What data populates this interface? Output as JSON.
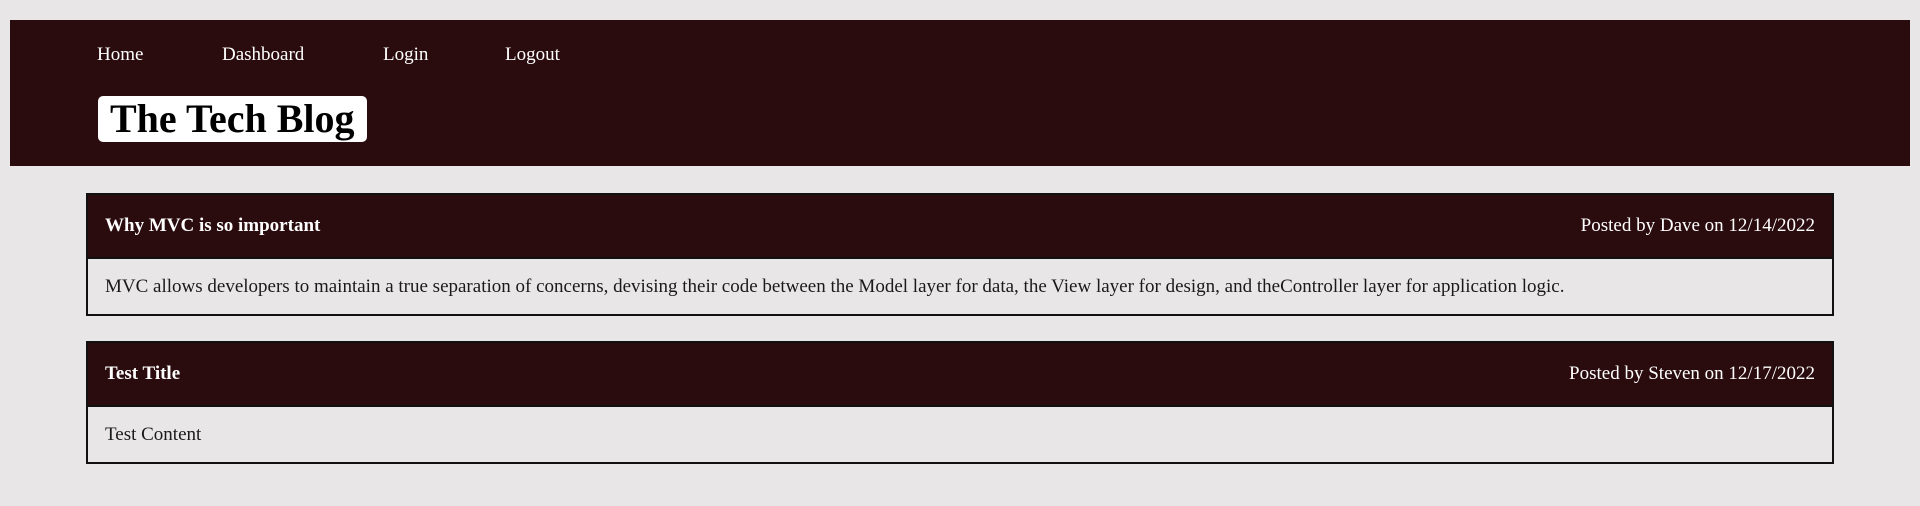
{
  "colors": {
    "page_background": "#e8e6e6",
    "header_background": "#2b0c0e",
    "title_box_background": "#ffffff",
    "post_header_background": "#2b0c0e",
    "border": "#111111"
  },
  "nav": {
    "items": [
      {
        "label": "Home"
      },
      {
        "label": "Dashboard"
      },
      {
        "label": "Login"
      },
      {
        "label": "Logout"
      }
    ]
  },
  "header": {
    "site_title": "The Tech Blog"
  },
  "posts": [
    {
      "title": "Why MVC is so important",
      "meta": "Posted by Dave on 12/14/2022",
      "content": "MVC allows developers to maintain a true separation of concerns, devising their code between the Model layer for data, the View layer for design, and theController layer for application logic."
    },
    {
      "title": "Test Title",
      "meta": "Posted by Steven on 12/17/2022",
      "content": "Test Content"
    }
  ]
}
